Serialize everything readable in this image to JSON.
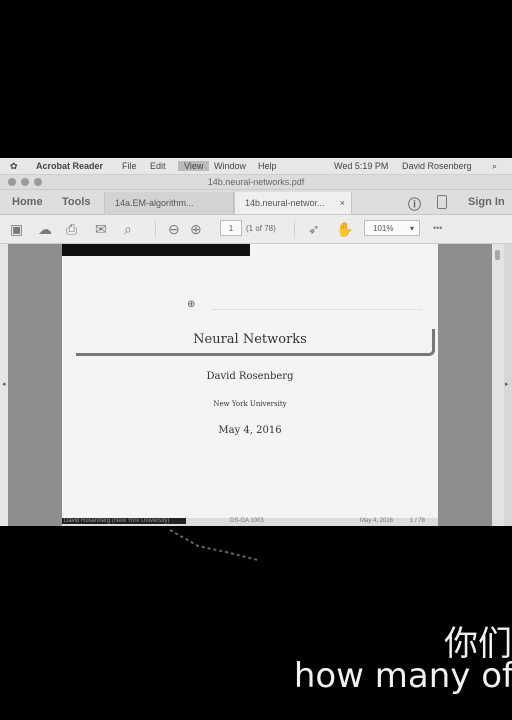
{
  "menubar": {
    "apple": "✿",
    "app": "Acrobat Reader",
    "items": [
      "File",
      "Edit",
      "View",
      "Window",
      "Help"
    ],
    "clock": "Wed 5:19 PM",
    "user": "David Rosenberg"
  },
  "window": {
    "title": "14b.neural-networks.pdf"
  },
  "nav": {
    "home": "Home",
    "tools": "Tools",
    "tabs": [
      {
        "label": "14a.EM-algorithm..."
      },
      {
        "label": "14b.neural-networ...",
        "close": "×"
      }
    ],
    "signin": "Sign In"
  },
  "toolbar": {
    "page_current": "1",
    "page_total": "(1 of 78)",
    "zoom": "101%",
    "more": "•••"
  },
  "page": {
    "title": "Neural Networks",
    "author": "David Rosenberg",
    "affiliation": "New York University",
    "date": "May 4, 2016",
    "footer_left": "David Rosenberg (New York University)",
    "footer_center": "DS-GA 1003",
    "footer_right": "May 4, 2016",
    "footer_page": "1 / 78"
  },
  "subtitle": {
    "zh": "你们",
    "en": "how many of"
  }
}
